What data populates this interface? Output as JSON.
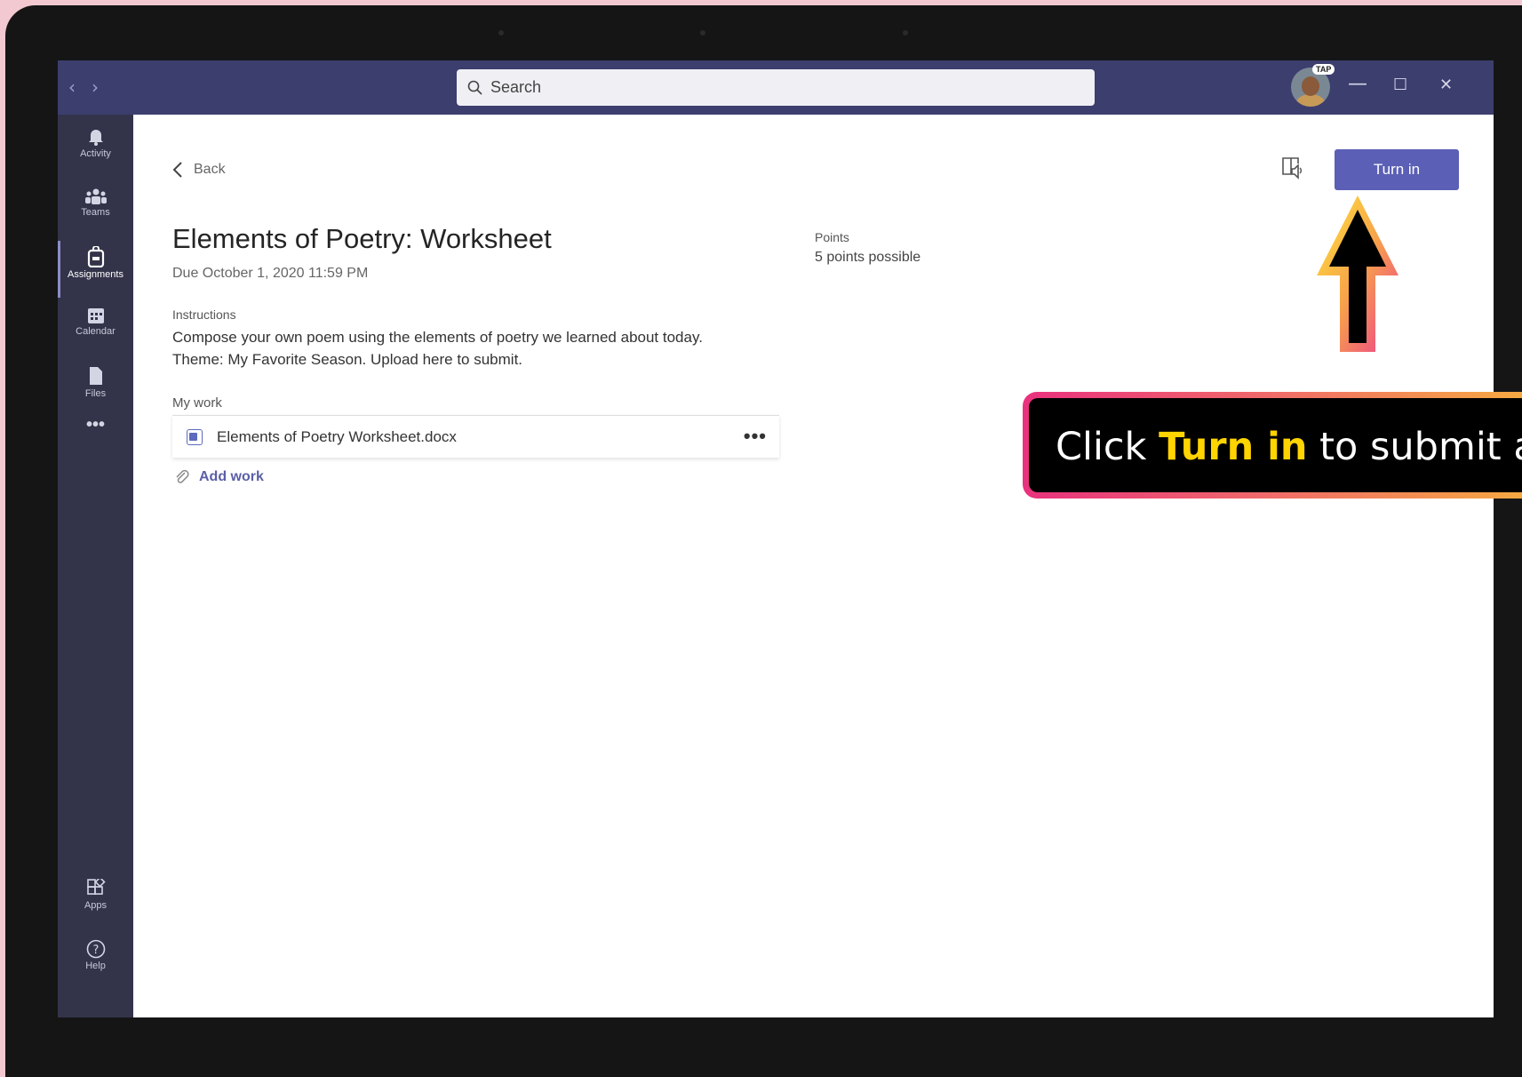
{
  "titlebar": {
    "search_placeholder": "Search",
    "badge": "TAP",
    "minimize": "—",
    "maximize": "☐",
    "close": "✕"
  },
  "rail": [
    {
      "label": "Activity",
      "icon": "bell-icon"
    },
    {
      "label": "Teams",
      "icon": "teams-icon"
    },
    {
      "label": "Assignments",
      "icon": "assignments-icon",
      "active": true
    },
    {
      "label": "Calendar",
      "icon": "calendar-icon"
    },
    {
      "label": "Files",
      "icon": "files-icon"
    },
    {
      "label": "•••",
      "icon": "more-icon"
    },
    {
      "label": "Apps",
      "icon": "apps-icon"
    },
    {
      "label": "Help",
      "icon": "help-icon"
    }
  ],
  "assignment": {
    "back_label": "Back",
    "title": "Elements of Poetry: Worksheet",
    "due": "Due October 1, 2020 11:59 PM",
    "instructions_label": "Instructions",
    "instructions_line1": "Compose your own poem using the elements of poetry we learned about today.",
    "instructions_line2": "Theme: My Favorite Season. Upload here to submit.",
    "my_work_label": "My work",
    "file_name": "Elements of Poetry Worksheet.docx",
    "file_more": "•••",
    "add_work_label": "Add work",
    "points_label": "Points",
    "points_value": "5 points possible",
    "turn_in_label": "Turn in"
  },
  "callout": {
    "prefix": "Click ",
    "highlight": "Turn in",
    "suffix": " to submit as"
  },
  "colors": {
    "titlebar": "#3c3e6e",
    "rail": "#33344a",
    "accent": "#5b5fb5",
    "callout_highlight": "#ffd400"
  }
}
